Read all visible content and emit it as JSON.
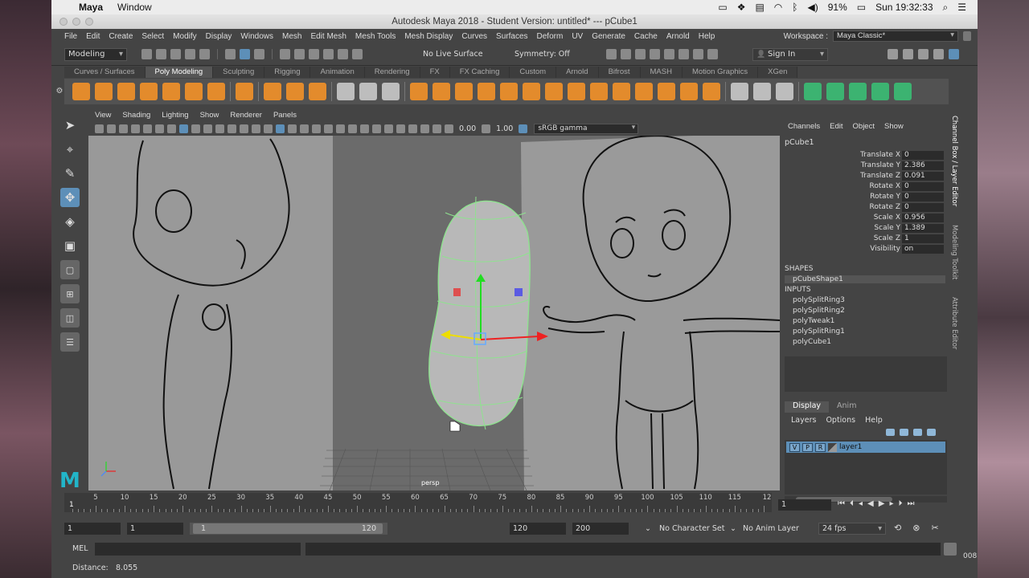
{
  "menubar": {
    "app": "Maya",
    "items": [
      "Window"
    ],
    "battery": "91%",
    "clock": "Sun 19:32:33"
  },
  "window": {
    "title": "Autodesk Maya 2018 - Student Version: untitled*  ---  pCube1"
  },
  "main_menu": {
    "items": [
      "File",
      "Edit",
      "Create",
      "Select",
      "Modify",
      "Display",
      "Windows",
      "Mesh",
      "Edit Mesh",
      "Mesh Tools",
      "Mesh Display",
      "Curves",
      "Surfaces",
      "Deform",
      "UV",
      "Generate",
      "Cache",
      "Arnold",
      "Help"
    ],
    "workspace_label": "Workspace :",
    "workspace_value": "Maya Classic*"
  },
  "status_line": {
    "mode": "Modeling",
    "live_surface": "No Live Surface",
    "symmetry": "Symmetry: Off",
    "sign_in": "Sign In"
  },
  "shelf_tabs": [
    "Curves / Surfaces",
    "Poly Modeling",
    "Sculpting",
    "Rigging",
    "Animation",
    "Rendering",
    "FX",
    "FX Caching",
    "Custom",
    "Arnold",
    "Bifrost",
    "MASH",
    "Motion Graphics",
    "XGen"
  ],
  "viewport": {
    "menu": [
      "View",
      "Shading",
      "Lighting",
      "Show",
      "Renderer",
      "Panels"
    ],
    "exposure": "0.00",
    "gamma_value": "1.00",
    "color_space": "sRGB gamma",
    "camera": "persp"
  },
  "channel_box": {
    "menu": [
      "Channels",
      "Edit",
      "Object",
      "Show"
    ],
    "object": "pCube1",
    "attributes": [
      {
        "name": "Translate X",
        "value": "0"
      },
      {
        "name": "Translate Y",
        "value": "2.386"
      },
      {
        "name": "Translate Z",
        "value": "0.091"
      },
      {
        "name": "Rotate X",
        "value": "0"
      },
      {
        "name": "Rotate Y",
        "value": "0"
      },
      {
        "name": "Rotate Z",
        "value": "0"
      },
      {
        "name": "Scale X",
        "value": "0.956"
      },
      {
        "name": "Scale Y",
        "value": "1.389"
      },
      {
        "name": "Scale Z",
        "value": "1"
      },
      {
        "name": "Visibility",
        "value": "on"
      }
    ],
    "shapes_label": "SHAPES",
    "shapes": [
      "pCubeShape1"
    ],
    "inputs_label": "INPUTS",
    "inputs": [
      "polySplitRing3",
      "polySplitRing2",
      "polyTweak1",
      "polySplitRing1",
      "polyCube1"
    ]
  },
  "layer_editor": {
    "tabs": [
      "Display",
      "Anim"
    ],
    "menu": [
      "Layers",
      "Options",
      "Help"
    ],
    "layer": {
      "v": "V",
      "p": "P",
      "r": "R",
      "name": "layer1"
    }
  },
  "side_tabs": [
    "Channel Box / Layer Editor",
    "Modeling Toolkit",
    "Attribute Editor"
  ],
  "time_slider": {
    "ticks": [
      "1",
      "5",
      "10",
      "15",
      "20",
      "25",
      "30",
      "35",
      "40",
      "45",
      "50",
      "55",
      "60",
      "65",
      "70",
      "75",
      "80",
      "85",
      "90",
      "95",
      "100",
      "105",
      "110",
      "115",
      "120"
    ],
    "current_frame": "1",
    "end_marker": "12"
  },
  "range": {
    "start": "1",
    "anim_start": "1",
    "slider_start": "1",
    "slider_end": "120",
    "anim_end": "120",
    "end": "200",
    "character_set": "No Character Set",
    "anim_layer": "No Anim Layer",
    "fps": "24 fps"
  },
  "command_line": {
    "lang": "MEL"
  },
  "help_line": {
    "label": "Distance:",
    "value": "8.055"
  },
  "corner_text": "008",
  "colors": {
    "accent": "#5d8fb8",
    "maya_logo": "#22b5c8",
    "shelf_orange": "#e38b2c"
  }
}
